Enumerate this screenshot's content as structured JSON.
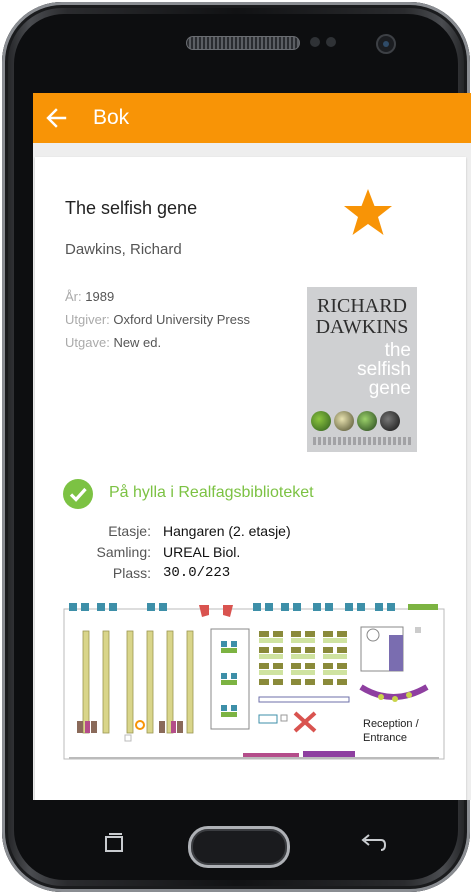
{
  "appbar": {
    "title": "Bok",
    "back_icon": "arrow-left-icon"
  },
  "book": {
    "title": "The selfish gene",
    "author": "Dawkins, Richard",
    "year_label": "År:",
    "year": "1989",
    "publisher_label": "Utgiver:",
    "publisher": "Oxford University Press",
    "edition_label": "Utgave:",
    "edition": "New ed.",
    "favorite_icon": "star-icon",
    "cover": {
      "line1": "RICHARD",
      "line2": "DAWKINS",
      "word1": "the",
      "word2": "selfish",
      "word3": "gene"
    }
  },
  "availability": {
    "status": "På hylla i Realfagsbiblioteket",
    "floor_label": "Etasje:",
    "floor": "Hangaren (2. etasje)",
    "collection_label": "Samling:",
    "collection": "UREAL Biol.",
    "shelf_label": "Plass:",
    "shelf": "30.0/223"
  },
  "map": {
    "reception_line1": "Reception /",
    "reception_line2": "Entrance"
  },
  "colors": {
    "accent": "#f89406",
    "available": "#7cc243",
    "star": "#f89406"
  }
}
